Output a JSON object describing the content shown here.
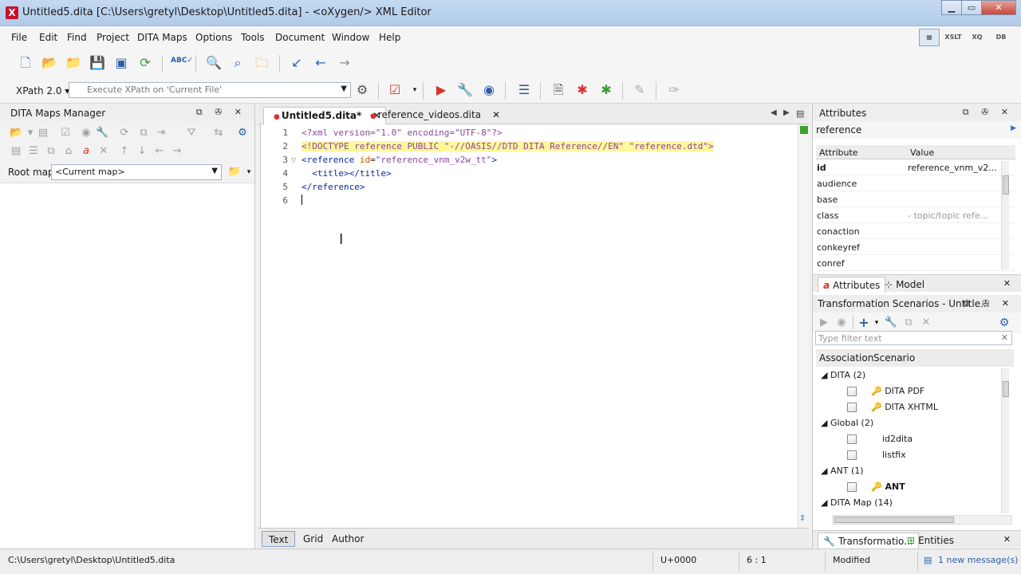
{
  "window": {
    "title": "Untitled5.dita [C:\\Users\\gretyl\\Desktop\\Untitled5.dita] - <oXygen/> XML Editor",
    "app_icon": "X"
  },
  "menu": [
    "File",
    "Edit",
    "Find",
    "Project",
    "DITA Maps",
    "Options",
    "Tools",
    "Document",
    "Window",
    "Help"
  ],
  "perspectives": [
    "▦",
    "XSLT",
    "XQ",
    "DB"
  ],
  "xpath": {
    "version": "XPath 2.0",
    "placeholder": "Execute XPath on  'Current File'"
  },
  "dita_maps": {
    "title": "DITA Maps Manager",
    "root_map_label": "Root map:",
    "root_map_value": "<Current map>"
  },
  "editor": {
    "tabs": [
      {
        "label": "Untitled5.dita*",
        "modified": true
      },
      {
        "label": "reference_videos.dita",
        "modified": true
      }
    ],
    "lines": [
      {
        "n": "1",
        "pi": "<?xml version=\"1.0\" encoding=\"UTF-8\"?>"
      },
      {
        "n": "2",
        "doctype": "<!DOCTYPE reference PUBLIC \"-//OASIS//DTD DITA Reference//EN\" \"reference.dtd\">"
      },
      {
        "n": "3",
        "open": "<reference",
        "attr": " id",
        "eq": "=",
        "val": "\"reference_vnm_v2w_tt\"",
        "close": ">"
      },
      {
        "n": "4",
        "text": "  <title></title>"
      },
      {
        "n": "5",
        "text": "</reference>"
      },
      {
        "n": "6",
        "text": ""
      }
    ],
    "modes": [
      "Text",
      "Grid",
      "Author"
    ]
  },
  "attributes_panel": {
    "title": "Attributes",
    "element": "reference",
    "col_attribute": "Attribute",
    "col_value": "Value",
    "rows": [
      {
        "name": "id",
        "value": "reference_vnm_v2...",
        "bold": true
      },
      {
        "name": "audience",
        "value": ""
      },
      {
        "name": "base",
        "value": ""
      },
      {
        "name": "class",
        "value": "- topic/topic      refe...",
        "muted": true
      },
      {
        "name": "conaction",
        "value": ""
      },
      {
        "name": "conkeyref",
        "value": ""
      },
      {
        "name": "conref",
        "value": ""
      }
    ],
    "tabs": [
      "Attributes",
      "Model"
    ]
  },
  "transformation": {
    "title": "Transformation Scenarios - Untitle...",
    "filter_placeholder": "Type filter text",
    "col_association": "Association",
    "col_scenario": "Scenario",
    "groups": [
      {
        "label": "DITA (2)",
        "items": [
          {
            "name": "DITA PDF",
            "key": true
          },
          {
            "name": "DITA XHTML",
            "key": true
          }
        ]
      },
      {
        "label": "Global (2)",
        "items": [
          {
            "name": "id2dita",
            "key": false
          },
          {
            "name": "listfix",
            "key": false
          }
        ]
      },
      {
        "label": "ANT (1)",
        "items": [
          {
            "name": "ANT",
            "key": true,
            "bold": true
          }
        ]
      },
      {
        "label": "DITA Map (14)",
        "items": []
      }
    ],
    "tabs": [
      "Transformatio...",
      "Entities"
    ]
  },
  "status": {
    "path": "C:\\Users\\gretyl\\Desktop\\Untitled5.dita",
    "unicode": "U+0000",
    "position": "6 : 1",
    "state": "Modified",
    "messages": "1 new message(s)"
  }
}
